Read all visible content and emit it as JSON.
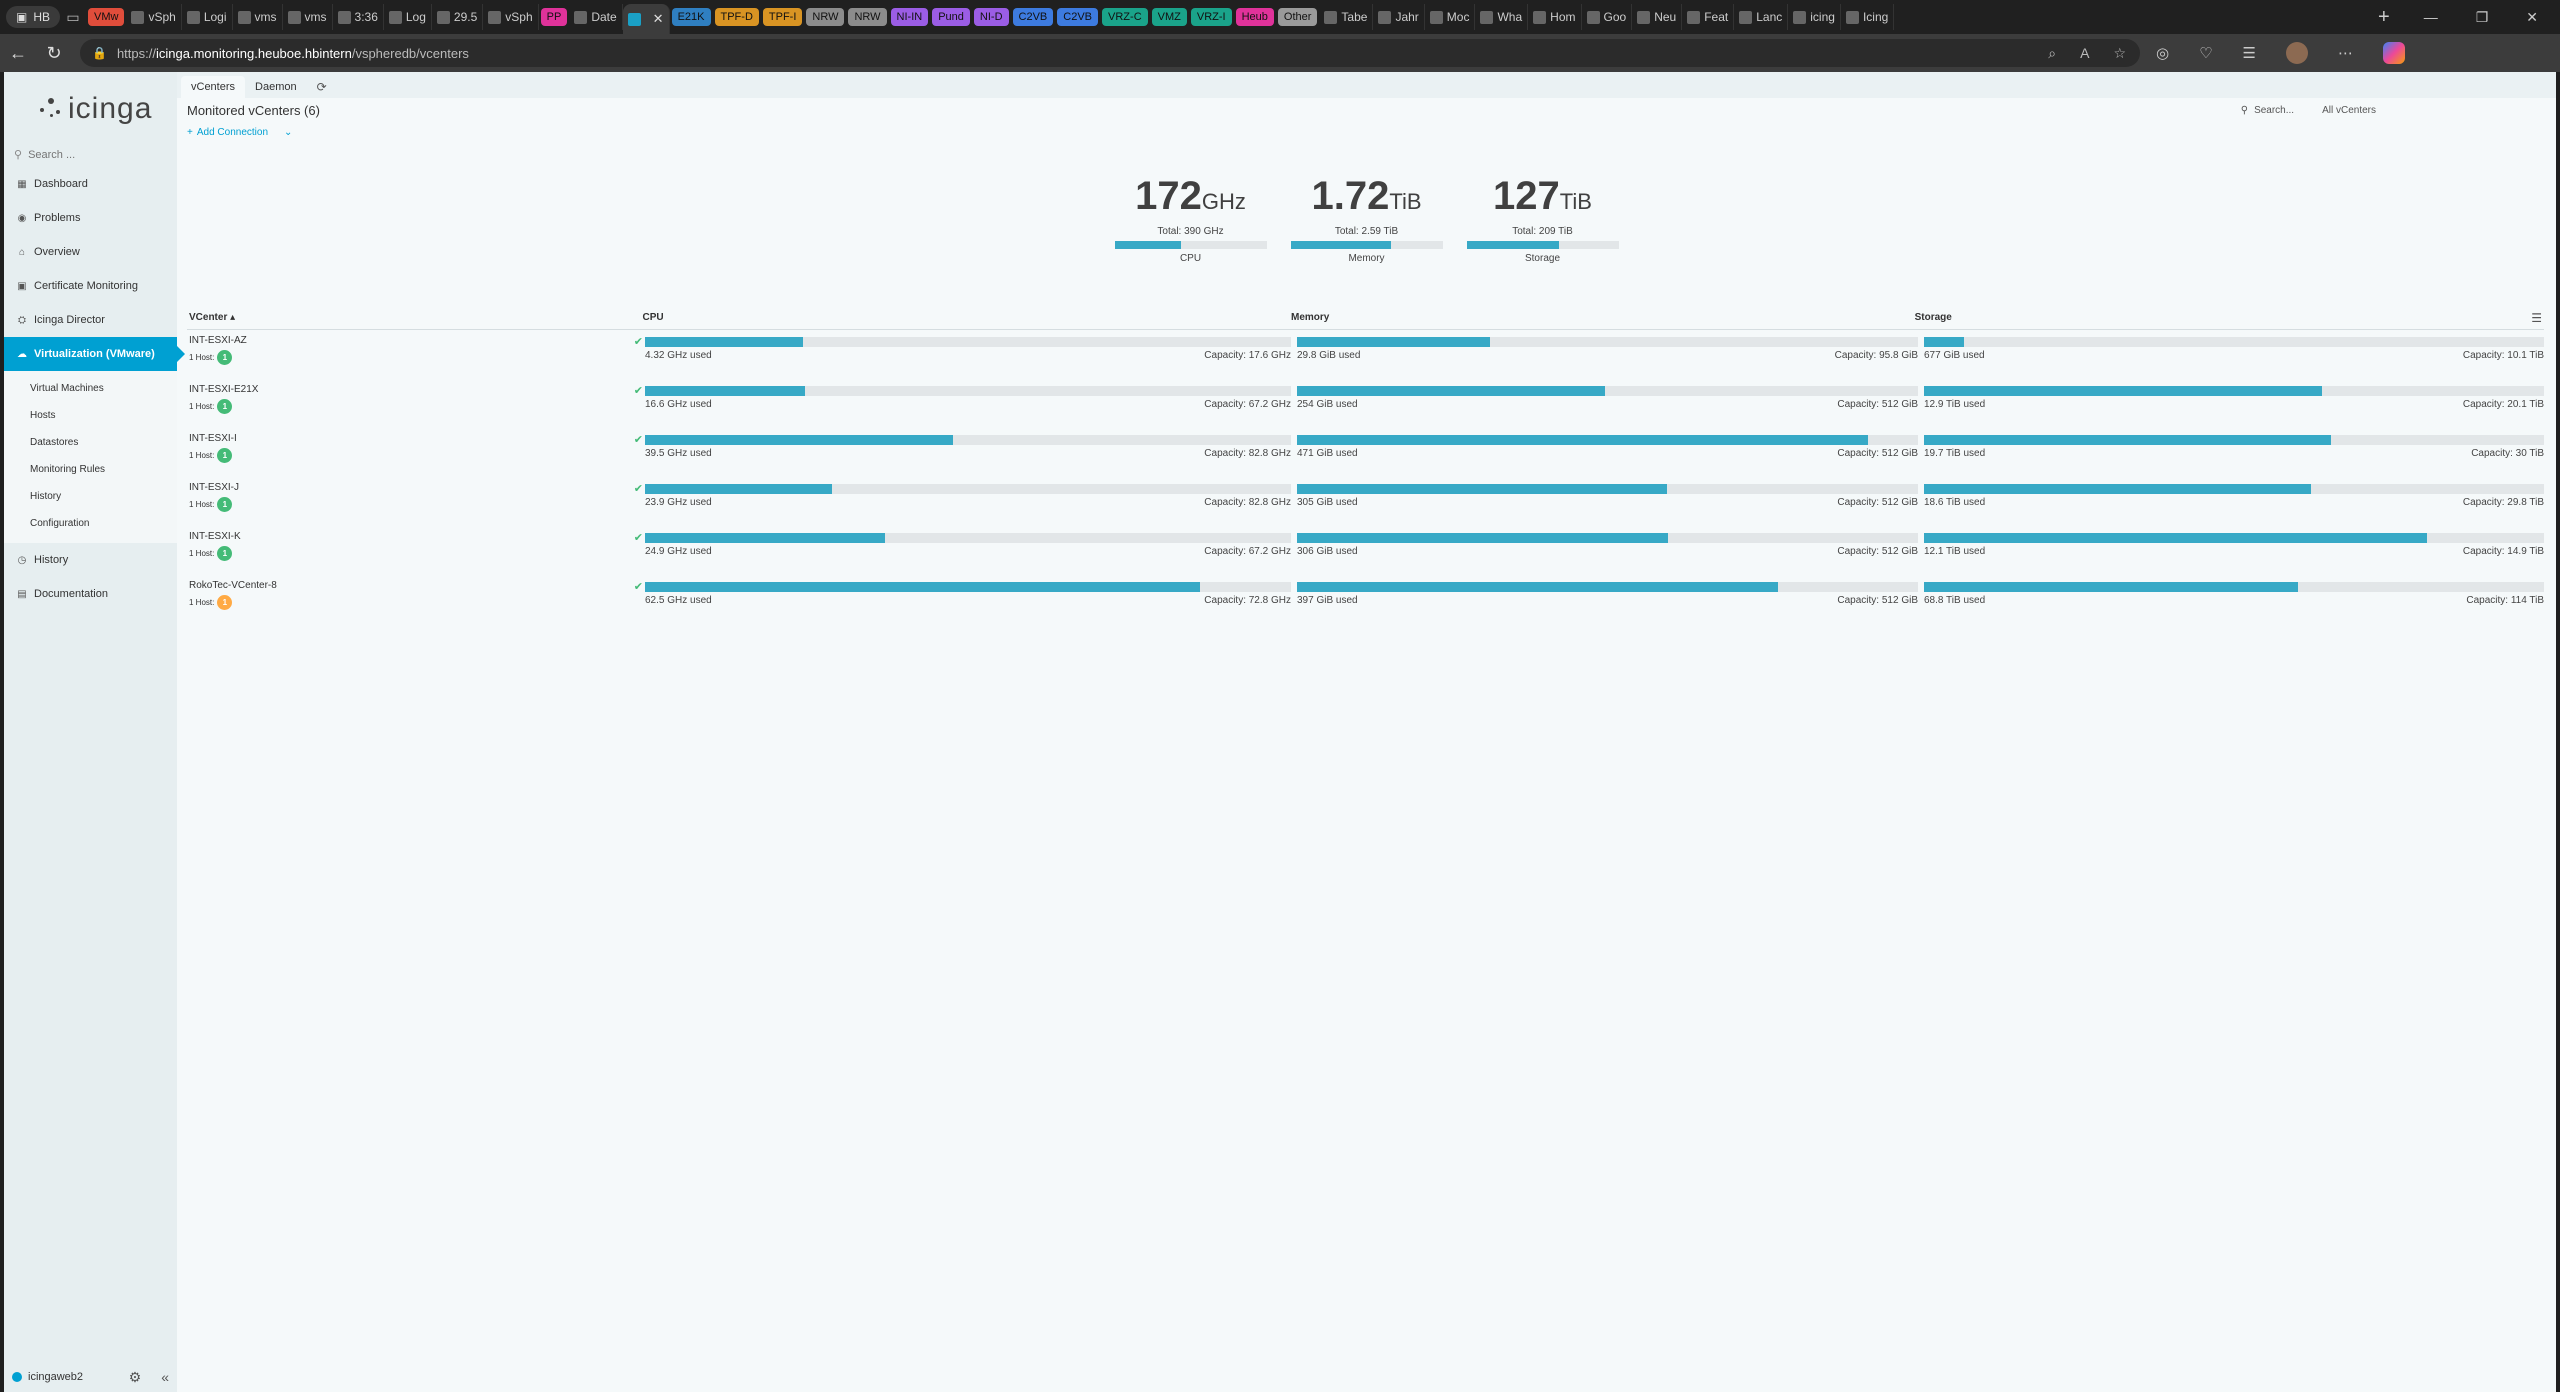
{
  "browser": {
    "profile": "HB",
    "tabs": [
      {
        "label": "VMw",
        "color": "#e04d3b"
      },
      {
        "label": "vSph"
      },
      {
        "label": "Logi"
      },
      {
        "label": "vms"
      },
      {
        "label": "vms"
      },
      {
        "label": "3:36"
      },
      {
        "label": "Log"
      },
      {
        "label": "29.5"
      },
      {
        "label": "vSph"
      },
      {
        "label": "PP",
        "color": "#e0329a"
      },
      {
        "label": "Date"
      },
      {
        "label": "",
        "active": true
      },
      {
        "label": "E21K",
        "color": "#2f7fc1"
      },
      {
        "label": "TPF-D",
        "color": "#d99423"
      },
      {
        "label": "TPF-I",
        "color": "#d99423"
      },
      {
        "label": "NRW",
        "color": "#8c8c8c"
      },
      {
        "label": "NRW",
        "color": "#8c8c8c"
      },
      {
        "label": "NI-IN",
        "color": "#9b5de5"
      },
      {
        "label": "Pund",
        "color": "#9b5de5"
      },
      {
        "label": "NI-D",
        "color": "#9b5de5"
      },
      {
        "label": "C2VB",
        "color": "#3d7be0"
      },
      {
        "label": "C2VB",
        "color": "#3d7be0"
      },
      {
        "label": "VRZ-C",
        "color": "#1aa38a"
      },
      {
        "label": "VMZ",
        "color": "#1aa38a"
      },
      {
        "label": "VRZ-I",
        "color": "#1aa38a"
      },
      {
        "label": "Heub",
        "color": "#e0329a"
      },
      {
        "label": "Other",
        "color": "#9a9a9a"
      },
      {
        "label": "Tabe"
      },
      {
        "label": "Jahr"
      },
      {
        "label": "Moc"
      },
      {
        "label": "Wha"
      },
      {
        "label": "Hom"
      },
      {
        "label": "Goo"
      },
      {
        "label": "Neu"
      },
      {
        "label": "Feat"
      },
      {
        "label": "Lanc"
      },
      {
        "label": "icing"
      },
      {
        "label": "Icing"
      }
    ],
    "url_prefix": "https://",
    "url_host": "icinga.monitoring.heuboe.hbintern",
    "url_path": "/vspheredb/vcenters"
  },
  "sidebar": {
    "logo": "icinga",
    "search_placeholder": "Search ...",
    "items": [
      {
        "label": "Dashboard",
        "icon": "dashboard-icon"
      },
      {
        "label": "Problems",
        "icon": "problems-icon"
      },
      {
        "label": "Overview",
        "icon": "overview-icon"
      },
      {
        "label": "Certificate Monitoring",
        "icon": "certificate-icon"
      },
      {
        "label": "Icinga Director",
        "icon": "director-icon"
      },
      {
        "label": "Virtualization (VMware)",
        "icon": "cloud-icon"
      }
    ],
    "sub_items": [
      "Virtual Machines",
      "Hosts",
      "Datastores",
      "Monitoring Rules",
      "History",
      "Configuration"
    ],
    "items_after": [
      {
        "label": "History",
        "icon": "history-icon"
      },
      {
        "label": "Documentation",
        "icon": "documentation-icon"
      }
    ],
    "user": "icingaweb2"
  },
  "tabs": {
    "vcenters": "vCenters",
    "daemon": "Daemon"
  },
  "page": {
    "title": "Monitored vCenters (6)",
    "search_placeholder": "Search...",
    "filter": "All vCenters",
    "add_connection": "Add Connection"
  },
  "summary": [
    {
      "value": "172",
      "unit": "GHz",
      "total": "Total: 390 GHz",
      "label": "CPU",
      "fill": 0.44
    },
    {
      "value": "1.72",
      "unit": "TiB",
      "total": "Total: 2.59 TiB",
      "label": "Memory",
      "fill": 0.66
    },
    {
      "value": "127",
      "unit": "TiB",
      "total": "Total: 209 TiB",
      "label": "Storage",
      "fill": 0.61
    }
  ],
  "table": {
    "headers": {
      "name": "VCenter",
      "cpu": "CPU",
      "memory": "Memory",
      "storage": "Storage"
    },
    "rows": [
      {
        "name": "INT-ESXI-AZ",
        "hosts_label": "1 Host:",
        "hosts": "1",
        "host_state": "ok",
        "cpu": {
          "used": "4.32 GHz used",
          "cap": "Capacity: 17.6 GHz",
          "fill": 0.245
        },
        "mem": {
          "used": "29.8 GiB used",
          "cap": "Capacity: 95.8 GiB",
          "fill": 0.311
        },
        "sto": {
          "used": "677 GiB used",
          "cap": "Capacity: 10.1 TiB",
          "fill": 0.065
        }
      },
      {
        "name": "INT-ESXI-E21X",
        "hosts_label": "1 Host:",
        "hosts": "1",
        "host_state": "ok",
        "cpu": {
          "used": "16.6 GHz used",
          "cap": "Capacity: 67.2 GHz",
          "fill": 0.247
        },
        "mem": {
          "used": "254 GiB used",
          "cap": "Capacity: 512 GiB",
          "fill": 0.496
        },
        "sto": {
          "used": "12.9 TiB used",
          "cap": "Capacity: 20.1 TiB",
          "fill": 0.642
        }
      },
      {
        "name": "INT-ESXI-I",
        "hosts_label": "1 Host:",
        "hosts": "1",
        "host_state": "ok",
        "cpu": {
          "used": "39.5 GHz used",
          "cap": "Capacity: 82.8 GHz",
          "fill": 0.477
        },
        "mem": {
          "used": "471 GiB used",
          "cap": "Capacity: 512 GiB",
          "fill": 0.92
        },
        "sto": {
          "used": "19.7 TiB used",
          "cap": "Capacity: 30 TiB",
          "fill": 0.657
        }
      },
      {
        "name": "INT-ESXI-J",
        "hosts_label": "1 Host:",
        "hosts": "1",
        "host_state": "ok",
        "cpu": {
          "used": "23.9 GHz used",
          "cap": "Capacity: 82.8 GHz",
          "fill": 0.289
        },
        "mem": {
          "used": "305 GiB used",
          "cap": "Capacity: 512 GiB",
          "fill": 0.596
        },
        "sto": {
          "used": "18.6 TiB used",
          "cap": "Capacity: 29.8 TiB",
          "fill": 0.624
        }
      },
      {
        "name": "INT-ESXI-K",
        "hosts_label": "1 Host:",
        "hosts": "1",
        "host_state": "ok",
        "cpu": {
          "used": "24.9 GHz used",
          "cap": "Capacity: 67.2 GHz",
          "fill": 0.371
        },
        "mem": {
          "used": "306 GiB used",
          "cap": "Capacity: 512 GiB",
          "fill": 0.598
        },
        "sto": {
          "used": "12.1 TiB used",
          "cap": "Capacity: 14.9 TiB",
          "fill": 0.812
        }
      },
      {
        "name": "RokoTec-VCenter-8",
        "hosts_label": "1 Host:",
        "hosts": "1",
        "host_state": "warn",
        "cpu": {
          "used": "62.5 GHz used",
          "cap": "Capacity: 72.8 GHz",
          "fill": 0.859
        },
        "mem": {
          "used": "397 GiB used",
          "cap": "Capacity: 512 GiB",
          "fill": 0.775
        },
        "sto": {
          "used": "68.8 TiB used",
          "cap": "Capacity: 114 TiB",
          "fill": 0.603
        }
      }
    ]
  }
}
